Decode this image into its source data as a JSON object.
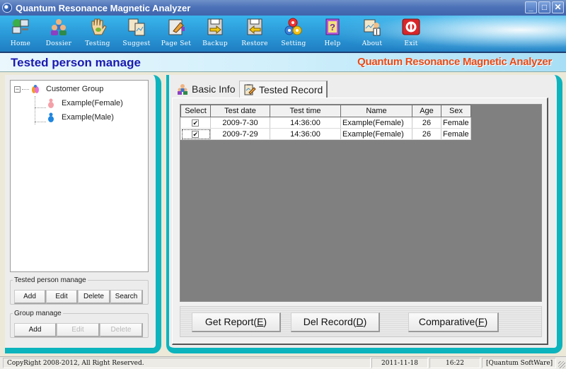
{
  "window": {
    "title": "Quantum Resonance Magnetic Analyzer",
    "controls": [
      "minimize",
      "maximize",
      "close"
    ]
  },
  "toolbar": {
    "items": [
      {
        "label": "Home",
        "icon": "computer-network-icon"
      },
      {
        "label": "Dossier",
        "icon": "people-icon"
      },
      {
        "label": "Testing",
        "icon": "hand-icon"
      },
      {
        "label": "Suggest",
        "icon": "clipboard-chart-icon"
      },
      {
        "label": "Page Set",
        "icon": "page-edit-icon"
      },
      {
        "label": "Backup",
        "icon": "disk-arrow-right-icon"
      },
      {
        "label": "Restore",
        "icon": "disk-arrow-left-icon"
      },
      {
        "label": "Setting",
        "icon": "gears-icon"
      },
      {
        "label": "Help",
        "icon": "help-book-icon"
      },
      {
        "label": "About",
        "icon": "about-person-icon"
      },
      {
        "label": "Exit",
        "icon": "power-icon"
      }
    ]
  },
  "header": {
    "title": "Tested person manage",
    "brand": "Quantum Resonance Magnetic Analyzer"
  },
  "tree": {
    "root": {
      "label": "Customer Group",
      "expanded": true
    },
    "children": [
      {
        "label": "Example(Female)",
        "gender": "female",
        "color": "#f4a0a8"
      },
      {
        "label": "Example(Male)",
        "gender": "male",
        "color": "#1f86e0"
      }
    ]
  },
  "tested_person_manage": {
    "legend": "Tested person manage",
    "buttons": [
      {
        "label": "Add",
        "enabled": true
      },
      {
        "label": "Edit",
        "enabled": true
      },
      {
        "label": "Delete",
        "enabled": true
      },
      {
        "label": "Search",
        "enabled": true
      }
    ]
  },
  "group_manage": {
    "legend": "Group manage",
    "buttons": [
      {
        "label": "Add",
        "enabled": true
      },
      {
        "label": "Edit",
        "enabled": false
      },
      {
        "label": "Delete",
        "enabled": false
      }
    ]
  },
  "tabs": [
    {
      "label": "Basic Info",
      "active": false
    },
    {
      "label": "Tested Record",
      "active": true
    }
  ],
  "records": {
    "columns": [
      "Select",
      "Test date",
      "Test time",
      "Name",
      "Age",
      "Sex"
    ],
    "rows": [
      {
        "selected": true,
        "test_date": "2009-7-30",
        "test_time": "14:36:00",
        "name": "Example(Female)",
        "age": "26",
        "sex": "Female"
      },
      {
        "selected": true,
        "test_date": "2009-7-29",
        "test_time": "14:36:00",
        "name": "Example(Female)",
        "age": "26",
        "sex": "Female"
      }
    ]
  },
  "actions": {
    "get_report": {
      "label": "Get Report(",
      "key": "E",
      "suffix": ")"
    },
    "del_record": {
      "label": "Del Record(",
      "key": "D",
      "suffix": ")"
    },
    "comparative": {
      "label": "Comparative(",
      "key": "F",
      "suffix": ")"
    }
  },
  "statusbar": {
    "copyright": "CopyRight 2008-2012, All Right Reserved.",
    "date": "2011-11-18",
    "time": "16:22",
    "vendor": "[Quantum SoftWare]"
  },
  "colors": {
    "accent_teal": "#0cb4bd",
    "title_blue": "#1a1ab0",
    "brand_orange": "#e84a17",
    "grid_background": "#808080"
  }
}
